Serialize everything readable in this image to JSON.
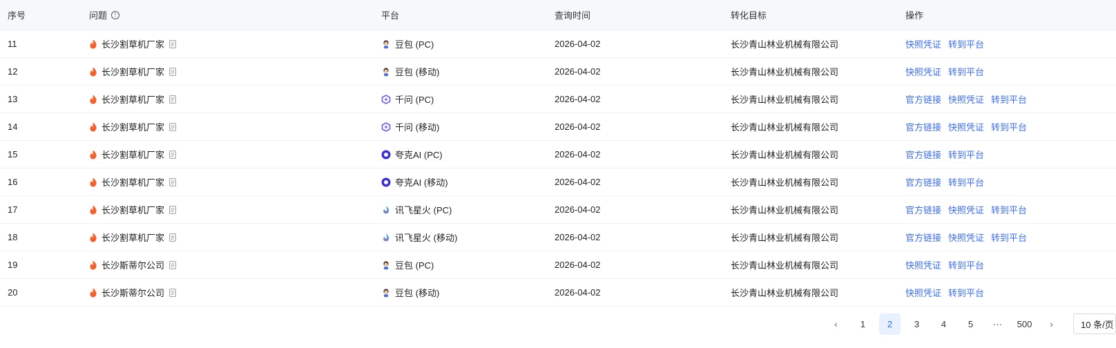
{
  "headers": {
    "index": "序号",
    "question": "问题",
    "platform": "平台",
    "query_time": "查询时间",
    "target": "转化目标",
    "ops": "操作"
  },
  "rows": [
    {
      "index": "11",
      "question": "长沙割草机厂家",
      "platform": "豆包 (PC)",
      "platform_icon": "doubao-icon",
      "time": "2026-04-02",
      "target": "长沙青山林业机械有限公司",
      "ops": [
        "快照凭证",
        "转到平台"
      ]
    },
    {
      "index": "12",
      "question": "长沙割草机厂家",
      "platform": "豆包 (移动)",
      "platform_icon": "doubao-icon",
      "time": "2026-04-02",
      "target": "长沙青山林业机械有限公司",
      "ops": [
        "快照凭证",
        "转到平台"
      ]
    },
    {
      "index": "13",
      "question": "长沙割草机厂家",
      "platform": "千问 (PC)",
      "platform_icon": "qianwen-icon",
      "time": "2026-04-02",
      "target": "长沙青山林业机械有限公司",
      "ops": [
        "官方链接",
        "快照凭证",
        "转到平台"
      ]
    },
    {
      "index": "14",
      "question": "长沙割草机厂家",
      "platform": "千问 (移动)",
      "platform_icon": "qianwen-icon",
      "time": "2026-04-02",
      "target": "长沙青山林业机械有限公司",
      "ops": [
        "官方链接",
        "快照凭证",
        "转到平台"
      ]
    },
    {
      "index": "15",
      "question": "长沙割草机厂家",
      "platform": "夸克AI (PC)",
      "platform_icon": "quark-icon",
      "time": "2026-04-02",
      "target": "长沙青山林业机械有限公司",
      "ops": [
        "官方链接",
        "转到平台"
      ]
    },
    {
      "index": "16",
      "question": "长沙割草机厂家",
      "platform": "夸克AI (移动)",
      "platform_icon": "quark-icon",
      "time": "2026-04-02",
      "target": "长沙青山林业机械有限公司",
      "ops": [
        "官方链接",
        "转到平台"
      ]
    },
    {
      "index": "17",
      "question": "长沙割草机厂家",
      "platform": "讯飞星火 (PC)",
      "platform_icon": "xinghuo-icon",
      "time": "2026-04-02",
      "target": "长沙青山林业机械有限公司",
      "ops": [
        "官方链接",
        "快照凭证",
        "转到平台"
      ]
    },
    {
      "index": "18",
      "question": "长沙割草机厂家",
      "platform": "讯飞星火 (移动)",
      "platform_icon": "xinghuo-icon",
      "time": "2026-04-02",
      "target": "长沙青山林业机械有限公司",
      "ops": [
        "官方链接",
        "快照凭证",
        "转到平台"
      ]
    },
    {
      "index": "19",
      "question": "长沙斯蒂尔公司",
      "platform": "豆包 (PC)",
      "platform_icon": "doubao-icon",
      "time": "2026-04-02",
      "target": "长沙青山林业机械有限公司",
      "ops": [
        "快照凭证",
        "转到平台"
      ]
    },
    {
      "index": "20",
      "question": "长沙斯蒂尔公司",
      "platform": "豆包 (移动)",
      "platform_icon": "doubao-icon",
      "time": "2026-04-02",
      "target": "长沙青山林业机械有限公司",
      "ops": [
        "快照凭证",
        "转到平台"
      ]
    }
  ],
  "pagination": {
    "prev": "‹",
    "next": "›",
    "pages": [
      "1",
      "2",
      "3",
      "4",
      "5"
    ],
    "ellipsis": "···",
    "last": "500",
    "current": "2",
    "page_size": "10 条/页"
  },
  "colors": {
    "link": "#3b6cf6",
    "fire": "#f5602a",
    "active_page_bg": "#e8f1ff",
    "header_bg": "#f7f8fa"
  }
}
